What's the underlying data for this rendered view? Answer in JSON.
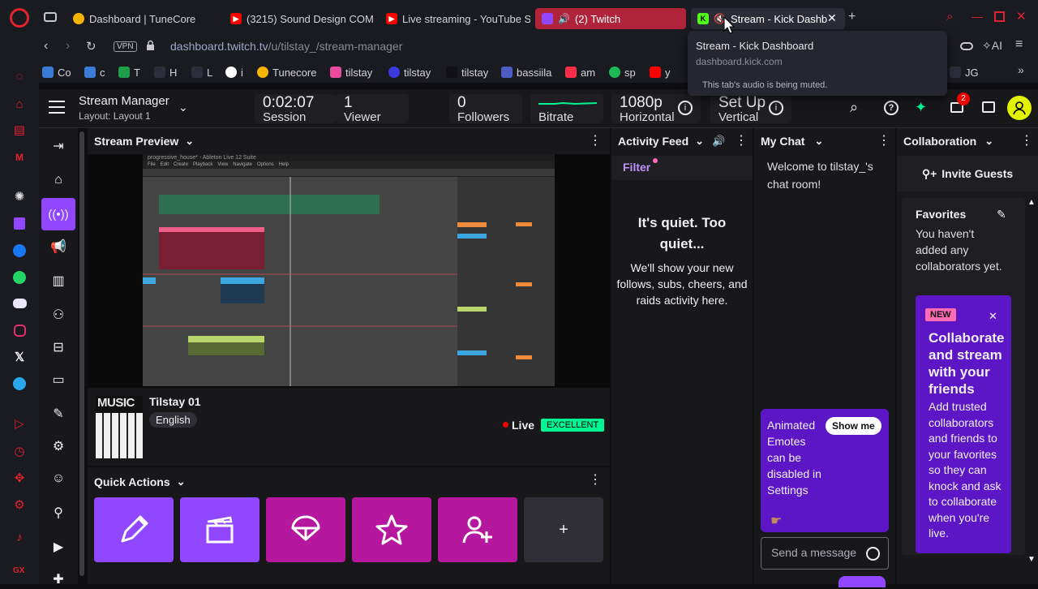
{
  "browser": {
    "tabs": [
      {
        "title": "Dashboard | TuneCore",
        "icon": "tunecore-icon"
      },
      {
        "title": "(3215) Sound Design COM",
        "icon": "youtube-icon"
      },
      {
        "title": "Live streaming - YouTube S",
        "icon": "youtube-icon"
      },
      {
        "title": "(2) Twitch",
        "icon": "twitch-icon"
      },
      {
        "title": "Stream - Kick Dashb",
        "icon": "kick-icon"
      }
    ],
    "vpn": "VPN",
    "url_domain": "dashboard.twitch.tv",
    "url_path": "/u/tilstay_/stream-manager",
    "ai_label": "AI",
    "bookmarks": [
      "Co",
      "c",
      "T",
      "H",
      "L",
      "i",
      "Tunecore",
      "tilstay",
      "tilstay",
      "tilstay",
      "bassiila",
      "am",
      "sp",
      "y",
      "JG"
    ],
    "tooltip": {
      "title": "Stream - Kick Dashboard",
      "url": "dashboard.kick.com",
      "note": "This tab's audio is being muted."
    },
    "sidebar_bottom": "GX"
  },
  "header": {
    "title": "Stream Manager",
    "layout": "Layout: Layout 1",
    "session_value": "0:02:07",
    "session_label": "Session",
    "viewer_value": "1",
    "viewer_label": "Viewer",
    "followers_value": "0",
    "followers_label": "Followers",
    "bitrate_label": "Bitrate",
    "resolution_value": "1080p",
    "resolution_label": "Horizontal",
    "setup_value": "Set Up",
    "setup_label": "Vertical",
    "notification_count": "2"
  },
  "preview": {
    "title": "Stream Preview",
    "stream_title": "Tilstay 01",
    "category_art_text": "MUSIC",
    "language": "English",
    "live_label": "Live",
    "quality_badge": "EXCELLENT",
    "daw_title": "progressive_house* - Ableton Live 12 Suite",
    "daw_menus": [
      "File",
      "Edit",
      "Create",
      "Playback",
      "View",
      "Navigate",
      "Options",
      "Help"
    ]
  },
  "quick_actions": {
    "title": "Quick Actions",
    "buttons": [
      {
        "icon": "pencil-icon",
        "color": "#9147ff"
      },
      {
        "icon": "clapperboard-icon",
        "color": "#9147ff"
      },
      {
        "icon": "parachute-icon",
        "color": "#b5179e"
      },
      {
        "icon": "star-icon",
        "color": "#b5179e"
      },
      {
        "icon": "add-user-icon",
        "color": "#b5179e"
      }
    ],
    "add_label": "+"
  },
  "activity": {
    "title": "Activity Feed",
    "filter": "Filter",
    "empty_title": "It's quiet. Too quiet...",
    "empty_body": "We'll show your new follows, subs, cheers, and raids activity here."
  },
  "chat": {
    "title": "My Chat",
    "welcome": "Welcome to tilstay_'s chat room!",
    "promo_text": "Animated Emotes can be disabled in Settings",
    "show_me": "Show me",
    "input_placeholder": "Send a message"
  },
  "collab": {
    "title": "Collaboration",
    "invite": "Invite Guests",
    "favorites_title": "Favorites",
    "favorites_empty": "You haven't added any collaborators yet.",
    "new_badge": "NEW",
    "promo_title": "Collaborate and stream with your friends",
    "promo_body": "Add trusted collaborators and friends to your favorites so they can knock and ask to collaborate when you're live."
  },
  "colors": {
    "twitch_purple": "#9147ff",
    "live_red": "#eb0400",
    "excellent_green": "#00f593",
    "promo_purple": "#5c16c5"
  }
}
